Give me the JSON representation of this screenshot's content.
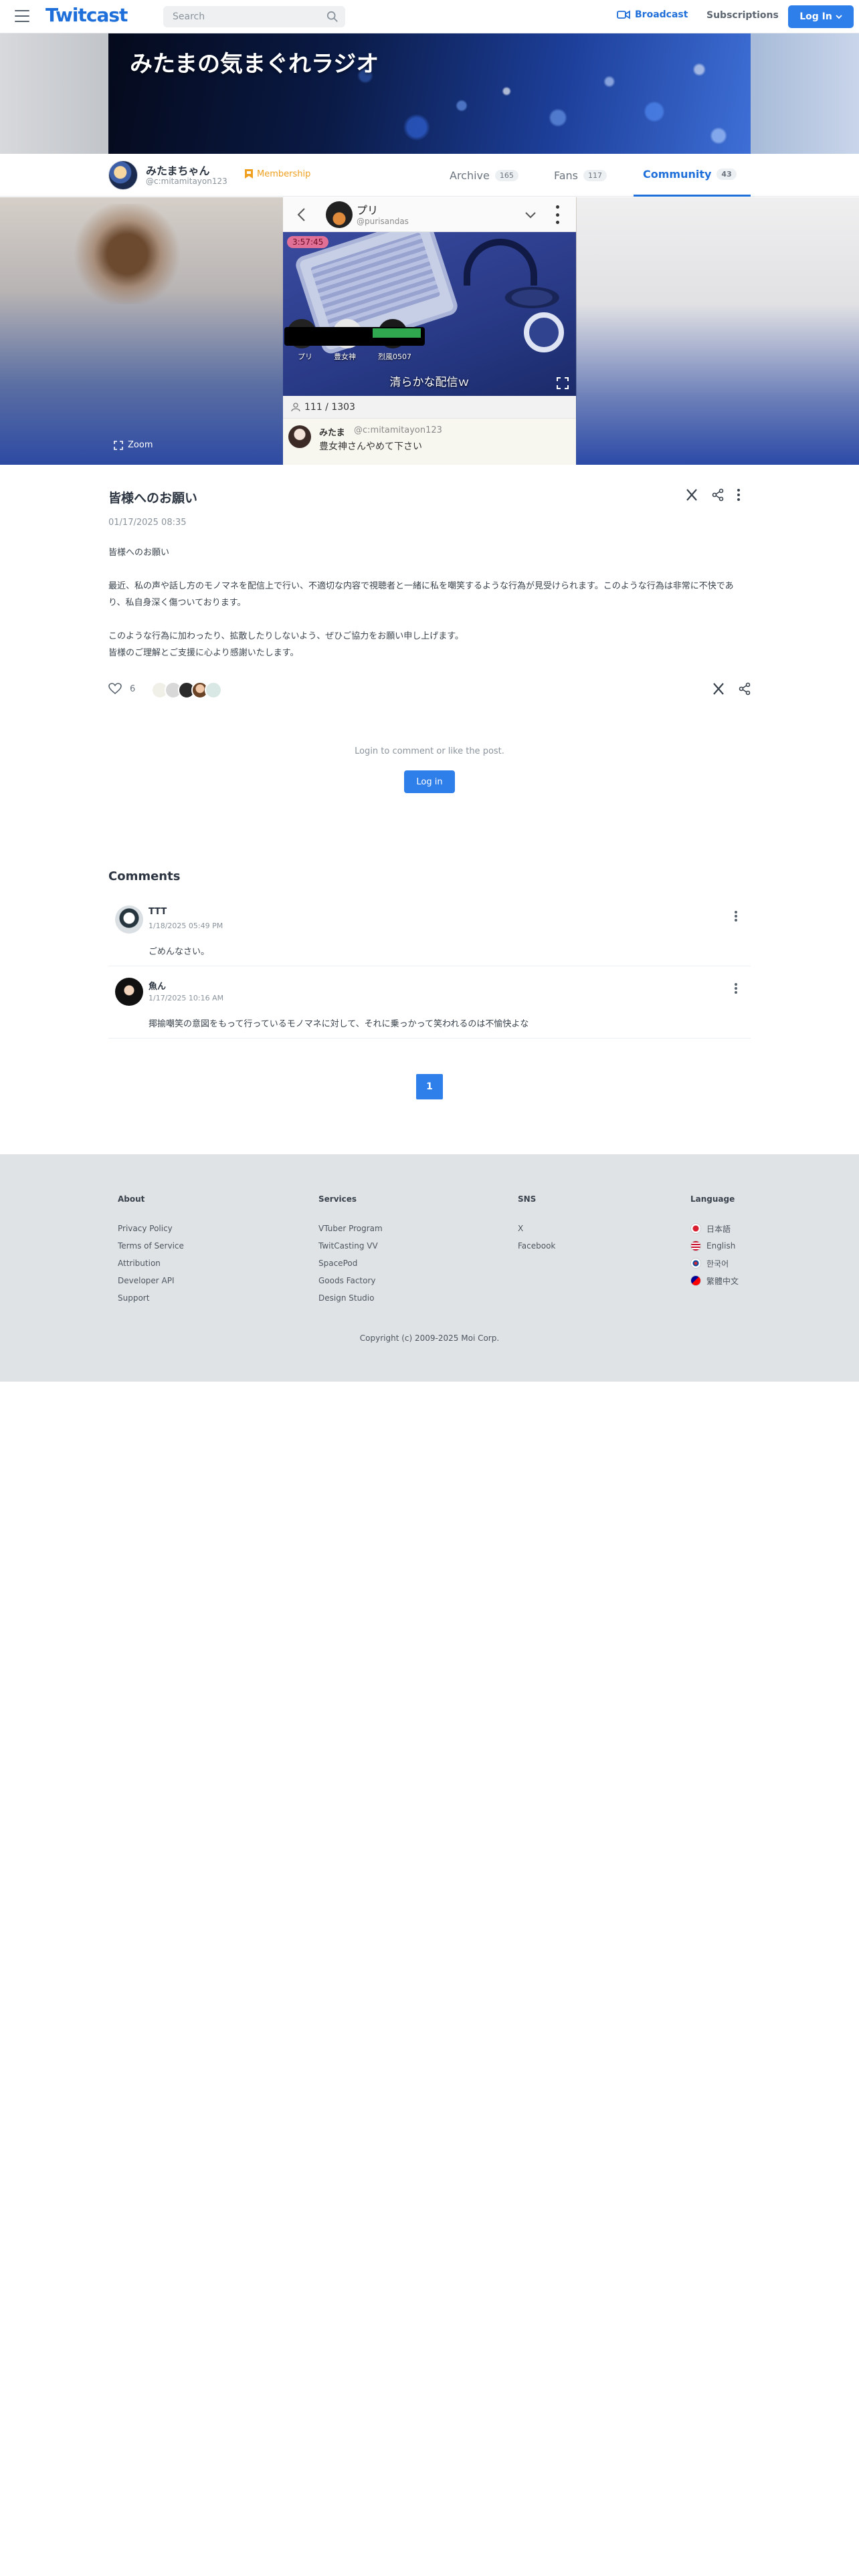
{
  "header": {
    "logo": "Twitcast",
    "search_placeholder": "Search",
    "broadcast_label": "Broadcast",
    "subscriptions_label": "Subscriptions",
    "login_label": "Log In",
    "accent_color": "#2f7fea"
  },
  "banner": {
    "title": "みたまの気まぐれラジオ"
  },
  "profile": {
    "name": "みたまちゃん",
    "handle": "@c:mitamitayon123",
    "membership_label": "Membership",
    "tabs": [
      {
        "label": "Archive",
        "count": "165"
      },
      {
        "label": "Fans",
        "count": "117"
      },
      {
        "label": "Community",
        "count": "43"
      }
    ]
  },
  "player": {
    "zoom_label": "Zoom",
    "broadcaster_name": "プリ",
    "broadcaster_handle": "@purisandas",
    "elapsed": "3:57:45",
    "participants": [
      "プリ",
      "豊女神",
      "烈風0507"
    ],
    "caption": "清らかな配信ｗ",
    "viewers": "111 / 1303",
    "chat": {
      "user": "みたま",
      "handle": "@c:mitamitayon123",
      "message": "豊女神さんやめて下さい"
    }
  },
  "post": {
    "title": "皆様へのお願い",
    "date": "01/17/2025 08:35",
    "body": [
      "皆様へのお願い",
      "",
      "最近、私の声や話し方のモノマネを配信上で行い、不適切な内容で視聴者と一緒に私を嘲笑するような行為が見受けられます。このような行為は非常に不快であり、私自身深く傷ついております。",
      "",
      "このような行為に加わったり、拡散したりしないよう、ぜひご協力をお願い申し上げます。",
      "皆様のご理解とご支援に心より感謝いたします。"
    ],
    "like_count": "6",
    "login_hint": "Login to comment or like the post.",
    "login_button": "Log in"
  },
  "comments": {
    "title": "Comments",
    "items": [
      {
        "user": "TTT",
        "date": "1/18/2025 05:49 PM",
        "text": "ごめんなさい。"
      },
      {
        "user": "魚ん",
        "date": "1/17/2025 10:16 AM",
        "text": "揶揄嘲笑の意図をもって行っているモノマネに対して、それに乗っかって笑われるのは不愉快よな"
      }
    ],
    "page": "1"
  },
  "footer": {
    "about": {
      "title": "About",
      "links": [
        "Privacy Policy",
        "Terms of Service",
        "Attribution",
        "Developer API",
        "Support"
      ]
    },
    "services": {
      "title": "Services",
      "links": [
        "VTuber Program",
        "TwitCasting VV",
        "SpacePod",
        "Goods Factory",
        "Design Studio"
      ]
    },
    "sns": {
      "title": "SNS",
      "links": [
        "X",
        "Facebook"
      ]
    },
    "language": {
      "title": "Language",
      "links": [
        "日本語",
        "English",
        "한국어",
        "繁體中文"
      ]
    },
    "copyright": "Copyright (c) 2009-2025 Moi Corp."
  }
}
